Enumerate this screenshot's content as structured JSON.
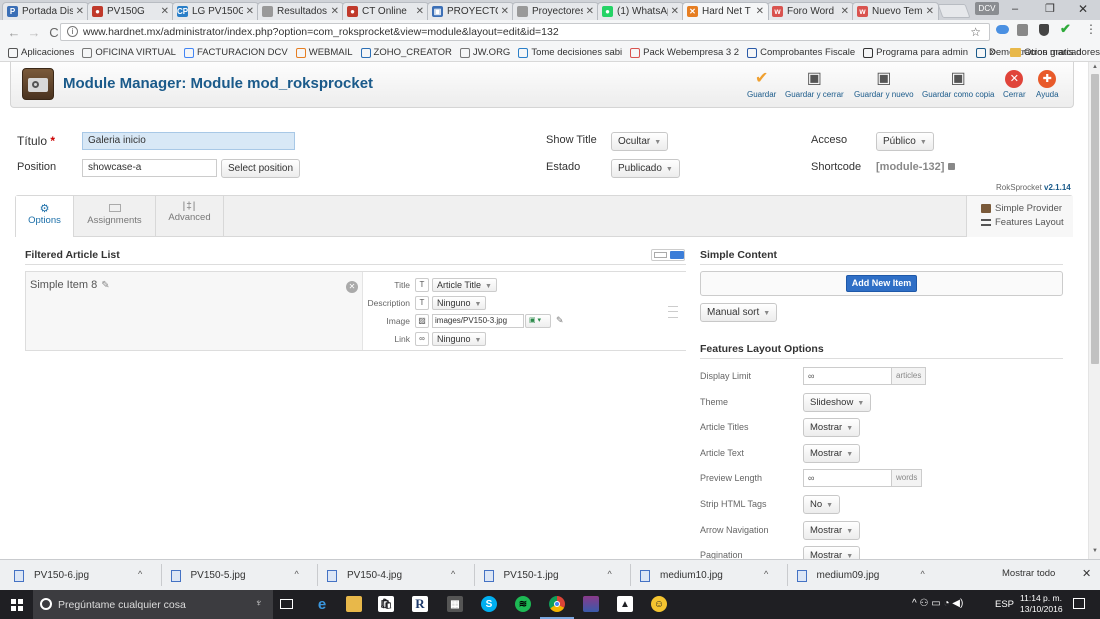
{
  "browser": {
    "tabs": [
      {
        "label": "Portada Dis",
        "color": "#3b6fb6",
        "glyph": "P",
        "active": false
      },
      {
        "label": "PV150G",
        "color": "#c0392b",
        "glyph": "●",
        "active": false
      },
      {
        "label": "LG PV150G",
        "color": "#2a7fc8",
        "glyph": "CP",
        "active": false
      },
      {
        "label": "Resultados",
        "color": "#999999",
        "glyph": "",
        "active": false
      },
      {
        "label": "CT Online",
        "color": "#c0392b",
        "glyph": "●",
        "active": false
      },
      {
        "label": "PROYECTOR",
        "color": "#3b6fb6",
        "glyph": "▣",
        "active": false
      },
      {
        "label": "Proyectores",
        "color": "#999999",
        "glyph": "",
        "active": false
      },
      {
        "label": "(1) WhatsAp",
        "color": "#25d366",
        "glyph": "●",
        "active": false
      },
      {
        "label": "Hard Net T",
        "color": "#e67e22",
        "glyph": "✕",
        "active": true
      },
      {
        "label": "Foro Word",
        "color": "#d9534f",
        "glyph": "w",
        "active": false
      },
      {
        "label": "Nuevo Tem",
        "color": "#d9534f",
        "glyph": "w",
        "active": false
      }
    ],
    "user_badge": "DCV",
    "url": "www.hardnet.mx/administrator/index.php?option=com_roksprocket&view=module&layout=edit&id=132",
    "bookmarks": [
      {
        "label": "Aplicaciones",
        "icon": "apps-icon"
      },
      {
        "label": "OFICINA VIRTUAL",
        "icon": "page-icon"
      },
      {
        "label": "FACTURACION DCV",
        "icon": "g-icon"
      },
      {
        "label": "WEBMAIL",
        "icon": "cp-icon"
      },
      {
        "label": "ZOHO_CREATOR",
        "icon": "zoho-icon"
      },
      {
        "label": "JW.ORG",
        "icon": "page-icon"
      },
      {
        "label": "Tome decisiones sabi",
        "icon": "flag-icon"
      },
      {
        "label": "Pack Webempresa 3 2",
        "icon": "w-icon"
      },
      {
        "label": "Comprobantes Fiscale",
        "icon": "grid-icon"
      },
      {
        "label": "Programa para admin",
        "icon": "m-icon"
      },
      {
        "label": "Demostracion gratis d",
        "icon": "c-icon"
      }
    ],
    "more_bookmarks": "»",
    "other_bookmarks": "Otros marcadores"
  },
  "toolbar": {
    "title": "Module Manager: Module mod_roksprocket",
    "buttons": [
      {
        "label": "Guardar",
        "icon": "checkmark-icon",
        "color": "#f0a030"
      },
      {
        "label": "Guardar y cerrar",
        "icon": "save-icon",
        "color": "#555555"
      },
      {
        "label": "Guardar y nuevo",
        "icon": "save-new-icon",
        "color": "#555555"
      },
      {
        "label": "Guardar como copia",
        "icon": "save-copy-icon",
        "color": "#555555"
      },
      {
        "label": "Cerrar",
        "icon": "close-icon",
        "color": "#e0443a"
      },
      {
        "label": "Ayuda",
        "icon": "help-icon",
        "color": "#e85a2a"
      }
    ]
  },
  "form": {
    "titulo_label": "Título",
    "titulo_required": "*",
    "titulo_value": "Galeria inicio",
    "position_label": "Position",
    "position_value": "showcase-a",
    "select_position": "Select position",
    "show_title_label": "Show Title",
    "show_title_value": "Ocultar",
    "estado_label": "Estado",
    "estado_value": "Publicado",
    "acceso_label": "Acceso",
    "acceso_value": "Público",
    "shortcode_label": "Shortcode",
    "shortcode_value": "[module-132]",
    "version_prefix": "RokSprocket ",
    "version": "v2.1.14"
  },
  "tabs": {
    "options": "Options",
    "assignments": "Assignments",
    "advanced": "Advanced",
    "provider": "Simple Provider",
    "layout": "Features Layout"
  },
  "article_list": {
    "title": "Filtered Article List",
    "item_name": "Simple Item 8",
    "fields": [
      {
        "label": "Title",
        "icon": "T",
        "value": "Article Title"
      },
      {
        "label": "Description",
        "icon": "T",
        "value": "Ninguno"
      },
      {
        "label": "Image",
        "icon": "img",
        "value": "images/PV150-3.jpg"
      },
      {
        "label": "Link",
        "icon": "link",
        "value": "Ninguno"
      }
    ]
  },
  "simple_content": {
    "title": "Simple Content",
    "add_new": "Add New Item",
    "sort": "Manual sort"
  },
  "features_layout": {
    "title": "Features Layout Options",
    "rows": [
      {
        "label": "Display Limit",
        "kind": "input",
        "value": "∞",
        "suffix": "articles"
      },
      {
        "label": "Theme",
        "kind": "select",
        "value": "Slideshow"
      },
      {
        "label": "Article Titles",
        "kind": "select",
        "value": "Mostrar"
      },
      {
        "label": "Article Text",
        "kind": "select",
        "value": "Mostrar"
      },
      {
        "label": "Preview Length",
        "kind": "input",
        "value": "∞",
        "suffix": "words"
      },
      {
        "label": "Strip HTML Tags",
        "kind": "select",
        "value": "No"
      },
      {
        "label": "Arrow Navigation",
        "kind": "select",
        "value": "Mostrar"
      },
      {
        "label": "Pagination",
        "kind": "select",
        "value": "Mostrar"
      }
    ]
  },
  "downloads": {
    "items": [
      "PV150-6.jpg",
      "PV150-5.jpg",
      "PV150-4.jpg",
      "PV150-1.jpg",
      "medium10.jpg",
      "medium09.jpg"
    ],
    "show_all": "Mostrar todo"
  },
  "taskbar": {
    "search_placeholder": "Pregúntame cualquier cosa",
    "language": "ESP",
    "time": "11:14 p. m.",
    "date": "13/10/2016"
  }
}
